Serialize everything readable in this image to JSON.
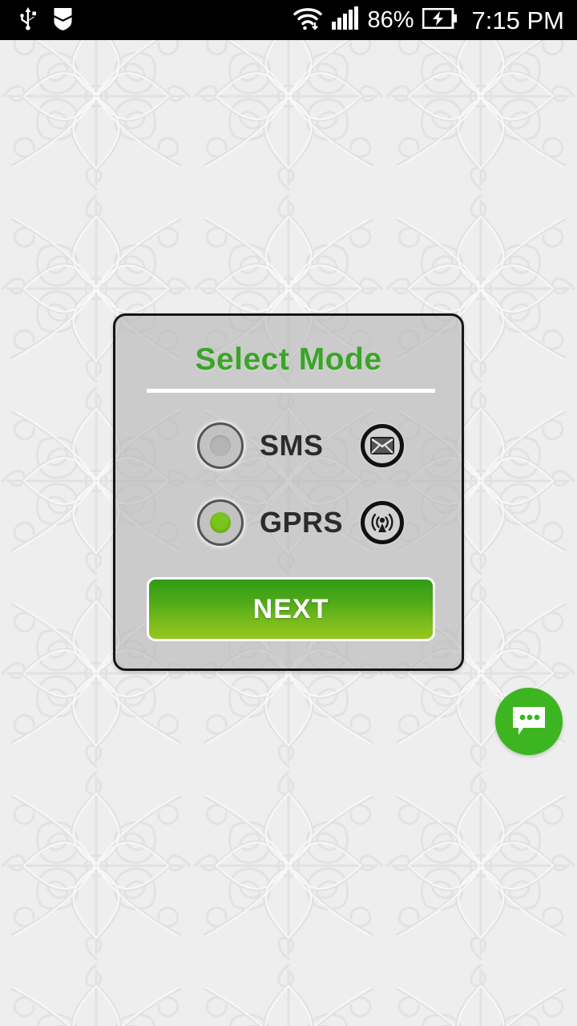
{
  "status_bar": {
    "background": "#000000",
    "left_icons": [
      {
        "name": "usb-icon",
        "label": "USB connected"
      },
      {
        "name": "shield-download-icon",
        "label": "Security shield"
      }
    ],
    "right_icons": [
      {
        "name": "wifi-icon",
        "label": "Wi-Fi connected"
      },
      {
        "name": "signal-bars-icon",
        "label": "Mobile signal full"
      },
      {
        "name": "battery-charging-icon",
        "label": "Battery charging"
      }
    ],
    "battery_percent": "86%",
    "clock": "7:15 PM"
  },
  "card": {
    "title": "Select Mode",
    "title_color": "#3aa528",
    "options": [
      {
        "id": "sms",
        "label": "SMS",
        "selected": false,
        "icon_name": "envelope-icon"
      },
      {
        "id": "gprs",
        "label": "GPRS",
        "selected": true,
        "icon_name": "broadcast-antenna-icon"
      }
    ],
    "selected_option": "GPRS",
    "primary_button": {
      "label": "NEXT",
      "gradient_top": "#2f9c15",
      "gradient_bottom": "#95c71f"
    }
  },
  "fab": {
    "name": "chat-bubble-fab",
    "label": "Messages",
    "color": "#3cb521"
  },
  "wallpaper": {
    "description": "Light grey embossed damask floral pattern",
    "base_color": "#eeeeee"
  }
}
